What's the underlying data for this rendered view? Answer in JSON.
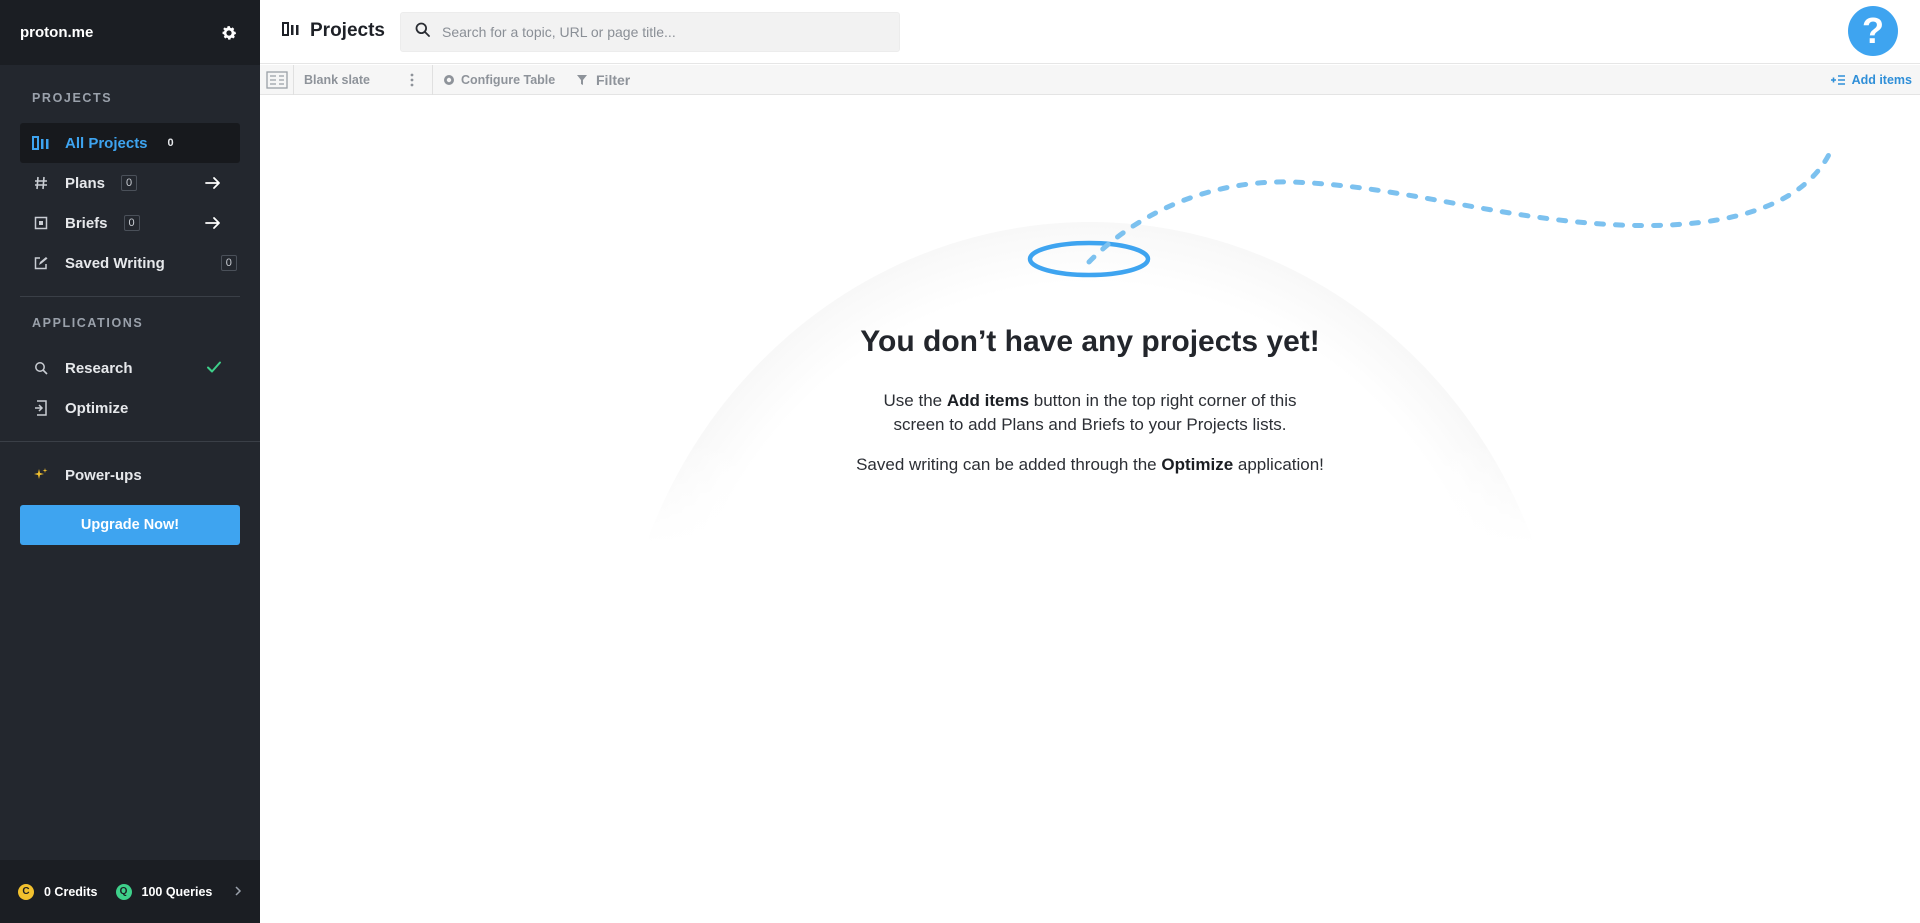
{
  "sidebar": {
    "brand": "proton.me",
    "projects_label": "PROJECTS",
    "items": [
      {
        "label": "All Projects",
        "count": "0"
      },
      {
        "label": "Plans",
        "count": "0"
      },
      {
        "label": "Briefs",
        "count": "0"
      },
      {
        "label": "Saved Writing",
        "count": "0"
      }
    ],
    "applications_label": "APPLICATIONS",
    "apps": [
      {
        "label": "Research"
      },
      {
        "label": "Optimize"
      }
    ],
    "powerups_label": "Power-ups",
    "upgrade_label": "Upgrade Now!",
    "credits": "0 Credits",
    "queries": "100 Queries"
  },
  "header": {
    "title": "Projects",
    "search_placeholder": "Search for a topic, URL or page title...",
    "help_glyph": "?"
  },
  "toolbar": {
    "view": "Blank slate",
    "configure": "Configure Table",
    "filter": "Filter",
    "add_items": "Add items"
  },
  "empty_state": {
    "title": "You don’t have any projects yet!",
    "line1_pre": "Use the ",
    "line1_bold": "Add items",
    "line1_post": " button in the top right corner of this",
    "line2": "screen to add Plans and Briefs to your Projects lists.",
    "line3_pre": "Saved writing can be added through the ",
    "line3_bold": "Optimize",
    "line3_post": " application!"
  },
  "colors": {
    "accent": "#3ea4f0",
    "sidebar_bg": "#23272e",
    "check": "#3ed08a",
    "credit_coin": "#f2c12e",
    "query_coin": "#3ed08a"
  }
}
